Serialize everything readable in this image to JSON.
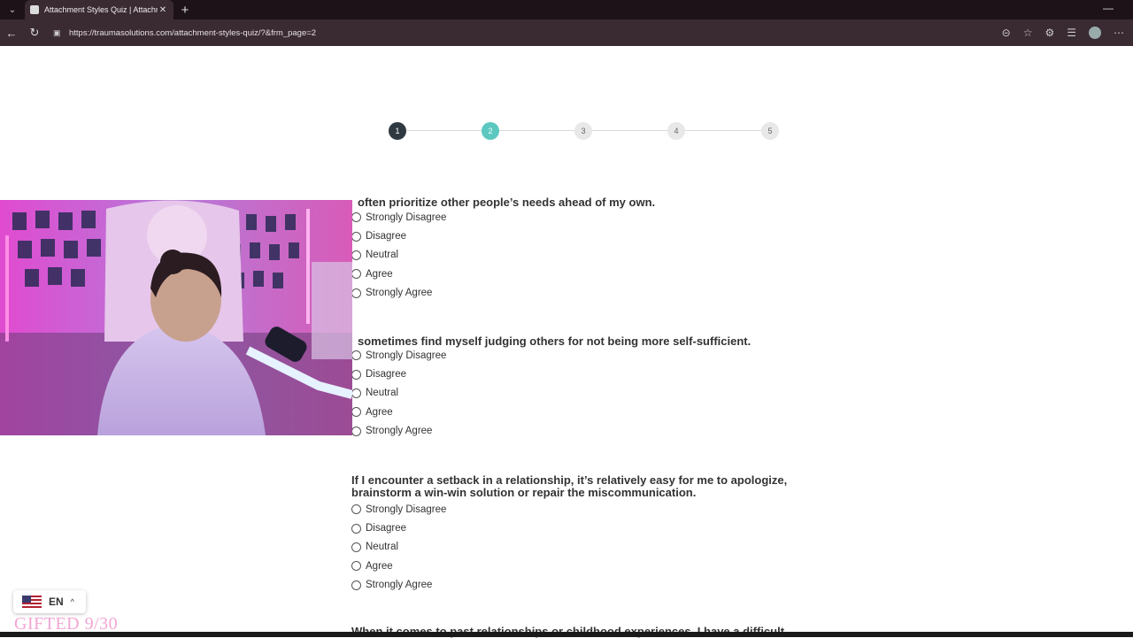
{
  "browser": {
    "tab_title": "Attachment Styles Quiz | Attachm",
    "tab_close": "✕",
    "new_tab": "+",
    "url": "https://traumasolutions.com/attachment-styles-quiz/?&frm_page=2"
  },
  "stepper": {
    "steps": [
      "1",
      "2",
      "3",
      "4",
      "5"
    ],
    "active_step": 2,
    "completed_color": "#2f3941",
    "active_color": "#5cc8c0"
  },
  "questions": [
    {
      "text": "often prioritize other people’s needs ahead of my own.",
      "options": [
        "Strongly Disagree",
        "Disagree",
        "Neutral",
        "Agree",
        "Strongly Agree"
      ]
    },
    {
      "text": "sometimes find myself judging others for not being more self-sufficient.",
      "options": [
        "Strongly Disagree",
        "Disagree",
        "Neutral",
        "Agree",
        "Strongly Agree"
      ]
    },
    {
      "text_line1": "If I encounter a setback in a relationship, it’s relatively easy for me to apologize,",
      "text_line2": "brainstorm a win-win solution or repair the miscommunication.",
      "options": [
        "Strongly Disagree",
        "Disagree",
        "Neutral",
        "Agree",
        "Strongly Agree"
      ]
    }
  ],
  "next_question_partial": "When it comes to past relationships or childhood experiences, I have a difficult",
  "language_selector": {
    "code": "EN",
    "caret": "^"
  },
  "overlay_text": "GIFTED 9/30"
}
